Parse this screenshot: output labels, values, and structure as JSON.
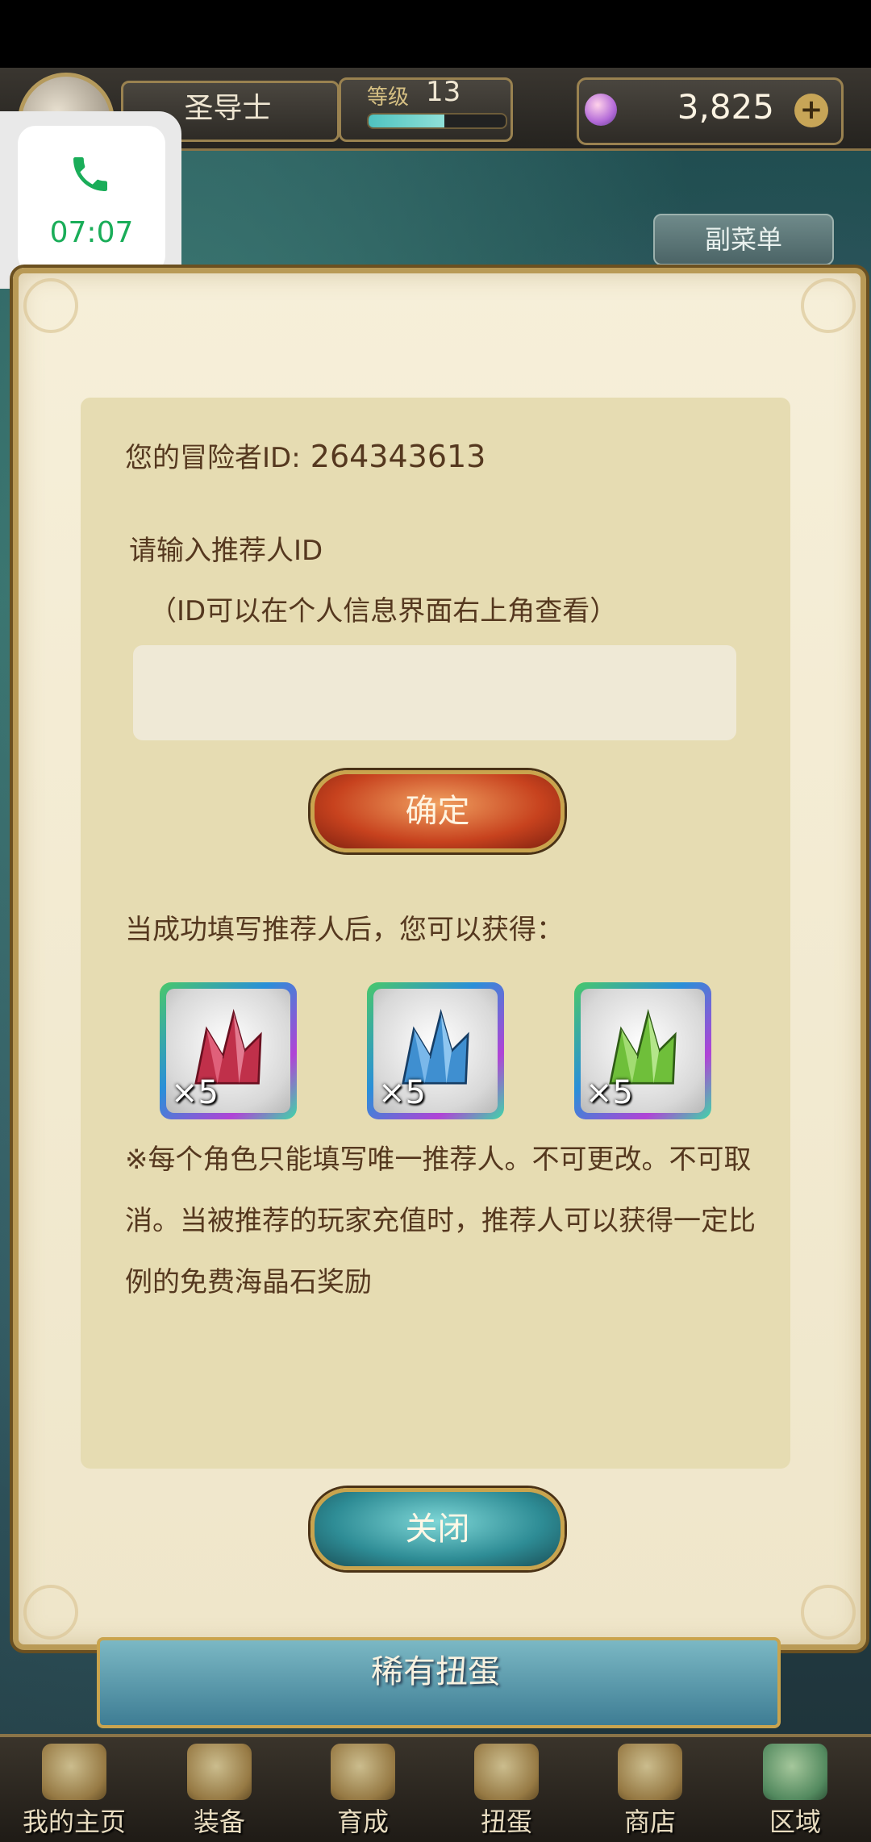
{
  "hud": {
    "player_class": "圣导士",
    "level_label": "等级",
    "level": "13",
    "exp_fraction": 0.55,
    "gems": "3,825",
    "add_label": "+"
  },
  "submenu_label": "副菜单",
  "call": {
    "time": "07:07"
  },
  "dialog": {
    "adventurer_id_label": "您的冒险者ID:",
    "adventurer_id": "264343613",
    "referrer_label": "请输入推荐人ID",
    "referrer_hint": "（ID可以在个人信息界面右上角查看）",
    "referrer_input_value": "",
    "confirm_label": "确定",
    "reward_text": "当成功填写推荐人后，您可以获得：",
    "rewards": [
      {
        "name": "red-crystal",
        "qty": "×5",
        "color": "#c0304a"
      },
      {
        "name": "blue-crystal",
        "qty": "×5",
        "color": "#3f8fd0"
      },
      {
        "name": "green-crystal",
        "qty": "×5",
        "color": "#6fbf3a"
      }
    ],
    "notice": "※每个角色只能填写唯一推荐人。不可更改。不可取消。当被推荐的玩家充值时，推荐人可以获得一定比例的免费海晶石奖励",
    "close_label": "关闭"
  },
  "rare_banner_label": "稀有扭蛋",
  "nav": [
    {
      "label": "我的主页",
      "icon": "home-scroll-icon"
    },
    {
      "label": "装备",
      "icon": "helmet-icon"
    },
    {
      "label": "育成",
      "icon": "sword-icon"
    },
    {
      "label": "扭蛋",
      "icon": "gacha-icon"
    },
    {
      "label": "商店",
      "icon": "shop-bag-icon"
    },
    {
      "label": "区域",
      "icon": "globe-icon"
    }
  ]
}
